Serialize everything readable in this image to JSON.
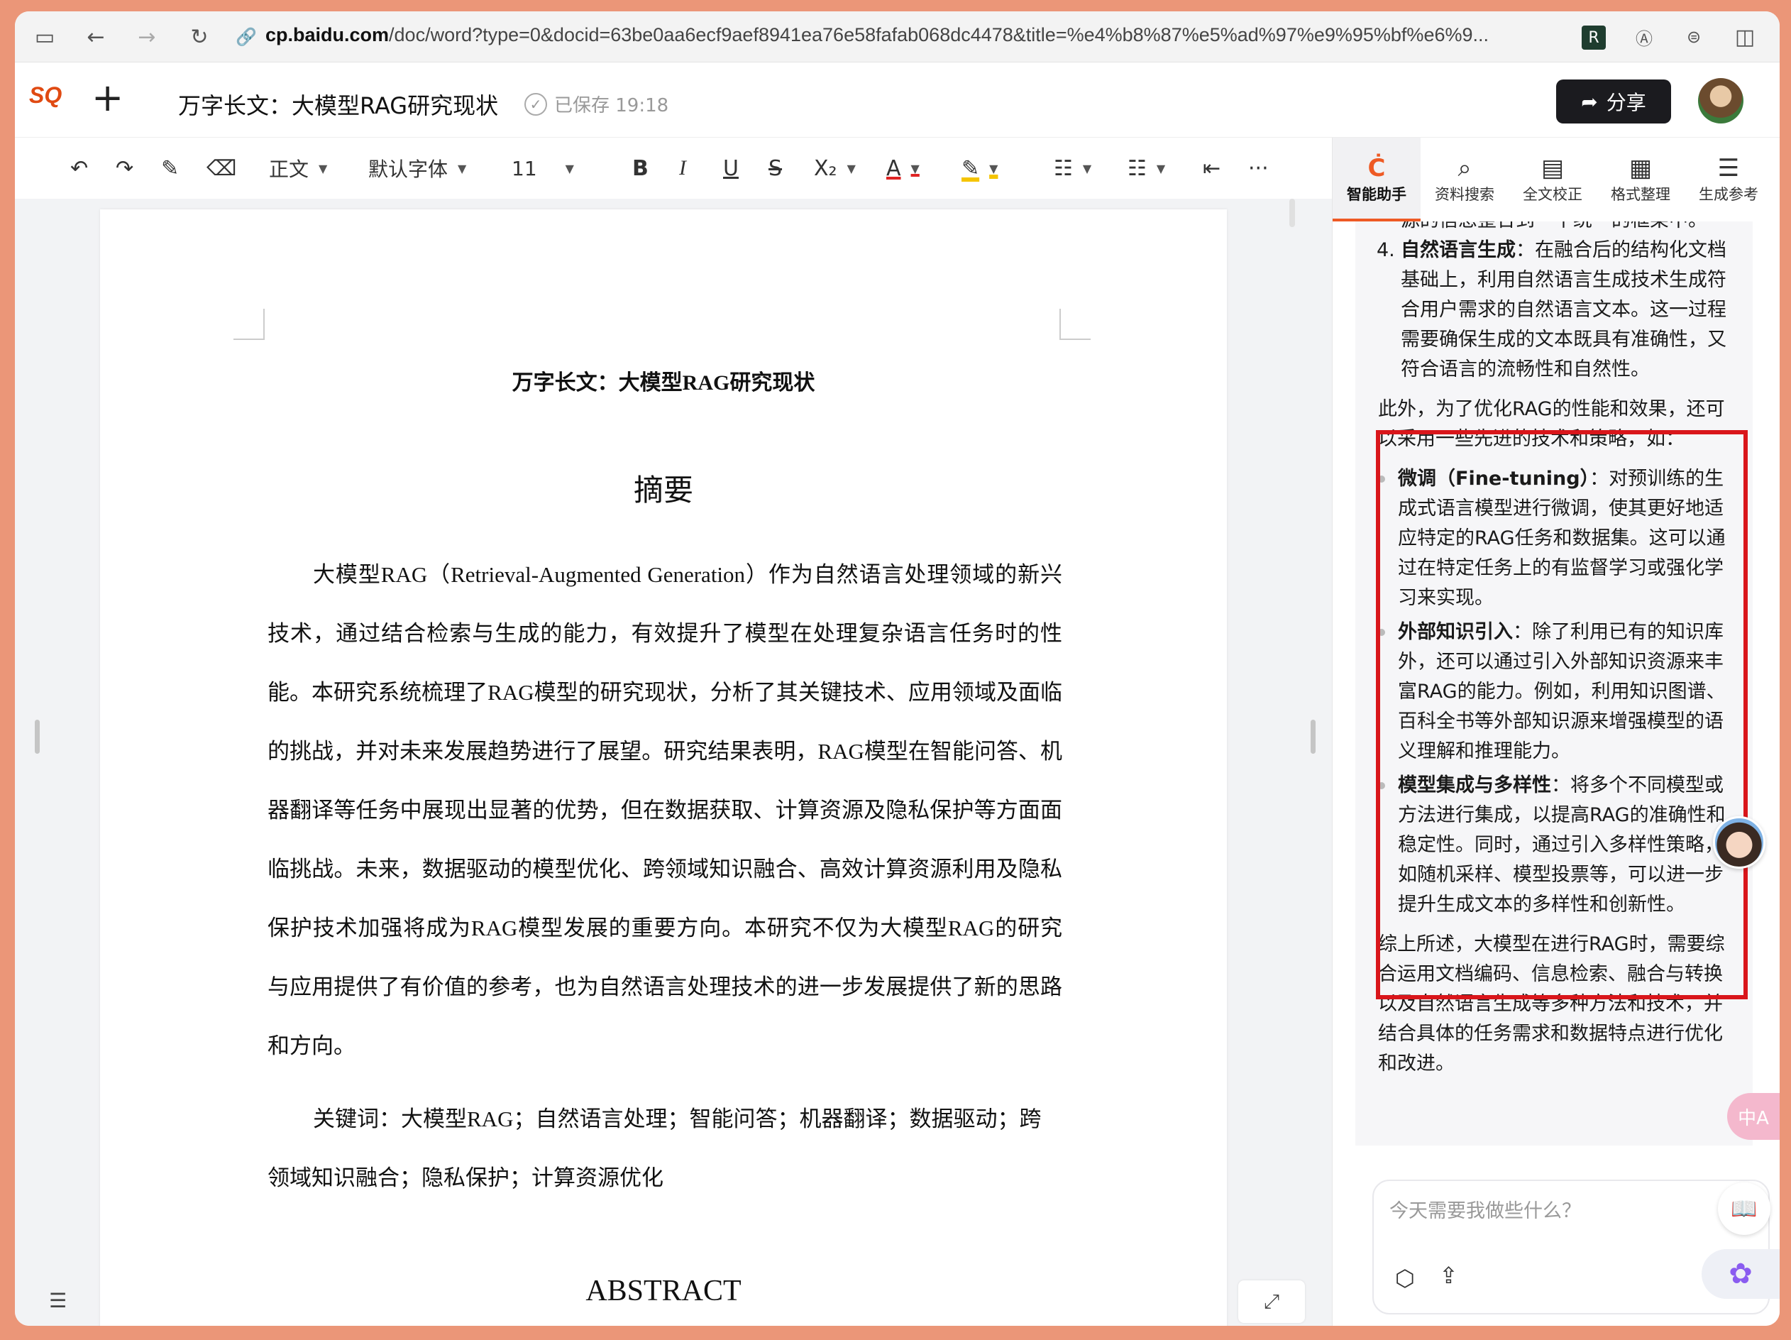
{
  "browser": {
    "url_domain": "cp.baidu.com",
    "url_path": "/doc/word?type=0&docid=63be0aa6ecf9aef8941ea76e58fafab068dc4478&title=%e4%b8%87%e5%ad%97%e9%95%bf%e6%9..."
  },
  "header": {
    "logo_text": "SQ",
    "doc_title": "万字长文：大模型RAG研究现状",
    "saved_status": "已保存 19:18",
    "share_label": "分享"
  },
  "toolbar": {
    "style_label": "正文",
    "font_label": "默认字体",
    "size_label": "11"
  },
  "document": {
    "title": "万字长文：大模型RAG研究现状",
    "abstract_heading": "摘要",
    "abstract_body": "大模型RAG（Retrieval-Augmented Generation）作为自然语言处理领域的新兴技术，通过结合检索与生成的能力，有效提升了模型在处理复杂语言任务时的性能。本研究系统梳理了RAG模型的研究现状，分析了其关键技术、应用领域及面临的挑战，并对未来发展趋势进行了展望。研究结果表明，RAG模型在智能问答、机器翻译等任务中展现出显著的优势，但在数据获取、计算资源及隐私保护等方面面临挑战。未来，数据驱动的模型优化、跨领域知识融合、高效计算资源利用及隐私保护技术加强将成为RAG模型发展的重要方向。本研究不仅为大模型RAG的研究与应用提供了有价值的参考，也为自然语言处理技术的进一步发展提供了新的思路和方向。",
    "keywords": "关键词：大模型RAG；自然语言处理；智能问答；机器翻译；数据驱动；跨领域知识融合；隐私保护；计算资源优化",
    "abstract_en_heading": "ABSTRACT"
  },
  "panel": {
    "tabs": [
      {
        "label": "智能助手",
        "icon": "assistant-icon",
        "glyph": "Ċ"
      },
      {
        "label": "资料搜索",
        "icon": "search-icon",
        "glyph": "⌕"
      },
      {
        "label": "全文校正",
        "icon": "proofread-icon",
        "glyph": "▤"
      },
      {
        "label": "格式整理",
        "icon": "format-icon",
        "glyph": "▦"
      },
      {
        "label": "生成参考",
        "icon": "reference-icon",
        "glyph": "☰"
      }
    ],
    "chat": {
      "cont_line": "源的信息整合到一个统一的框架中。",
      "item4_num": "4.",
      "item4_title": "自然语言生成",
      "item4_text": "：在融合后的结构化文档基础上，利用自然语言生成技术生成符合用户需求的自然语言文本。这一过程需要确保生成的文本既具有准确性，又符合语言的流畅性和自然性。",
      "intro": "此外，为了优化RAG的性能和效果，还可以采用一些先进的技术和策略，如：",
      "bullets": [
        {
          "title": "微调（Fine-tuning）",
          "text": "：对预训练的生成式语言模型进行微调，使其更好地适应特定的RAG任务和数据集。这可以通过在特定任务上的有监督学习或强化学习来实现。"
        },
        {
          "title": "外部知识引入",
          "text": "：除了利用已有的知识库外，还可以通过引入外部知识资源来丰富RAG的能力。例如，利用知识图谱、百科全书等外部知识源来增强模型的语义理解和推理能力。"
        },
        {
          "title": "模型集成与多样性",
          "text": "：将多个不同模型或方法进行集成，以提高RAG的准确性和稳定性。同时，通过引入多样性策略，如随机采样、模型投票等，可以进一步提升生成文本的多样性和创新性。"
        }
      ],
      "summary": "综上所述，大模型在进行RAG时，需要综合运用文档编码、信息检索、融合与转换以及自然语言生成等多种方法和技术，并结合具体的任务需求和数据特点进行优化和改进。"
    },
    "input_placeholder": "今天需要我做些什么？"
  },
  "floats": {
    "translate_label": "中A"
  }
}
